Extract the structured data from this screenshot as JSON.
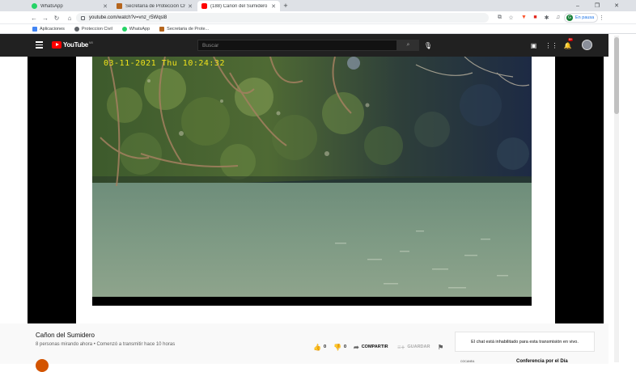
{
  "browser": {
    "tabs": [
      {
        "label": "WhatsApp",
        "color": "#25d366"
      },
      {
        "label": "Secretaría de Protección Civil - C...",
        "color": "#b5651d"
      },
      {
        "label": "(188) Cañon del Sumidero - YouT...",
        "color": "#ff0000"
      }
    ],
    "new_tab": "+",
    "window_controls": [
      "–",
      "❐",
      "✕"
    ],
    "url": "youtube.com/watch?v=vnz_r5Wqsl8",
    "profile_label": "En pausa",
    "profile_initial": "G",
    "bookmarks": [
      {
        "label": "Aplicaciones",
        "color": "#4285f4"
      },
      {
        "label": "Proteccion Civil",
        "color": "#5f6368"
      },
      {
        "label": "WhatsApp",
        "color": "#25d366"
      },
      {
        "label": "Secretaria de Prote...",
        "color": "#b5651d"
      }
    ]
  },
  "youtube": {
    "logo_text": "YouTube",
    "logo_country": "MX",
    "search_placeholder": "Buscar",
    "notifications_badge": "9+",
    "video_overlay_timestamp": "03-11-2021 Thu 10:24:32",
    "video_title": "Cañon del Sumidero",
    "video_meta": "8 personas mirando ahora • Comenzó a transmitir hace 10 horas",
    "likes": "0",
    "dislikes": "0",
    "share_label": "COMPARTIR",
    "save_label": "GUARDAR",
    "chat_disabled": "El chat está inhabilitado para esta transmisión en vivo.",
    "rec_title": "Conferencia por el Día",
    "rec_thumb_text": "COCANEA"
  },
  "colors": {
    "yt_header": "#212121",
    "yt_red": "#ff0000",
    "timestamp": "#f0e21c"
  }
}
